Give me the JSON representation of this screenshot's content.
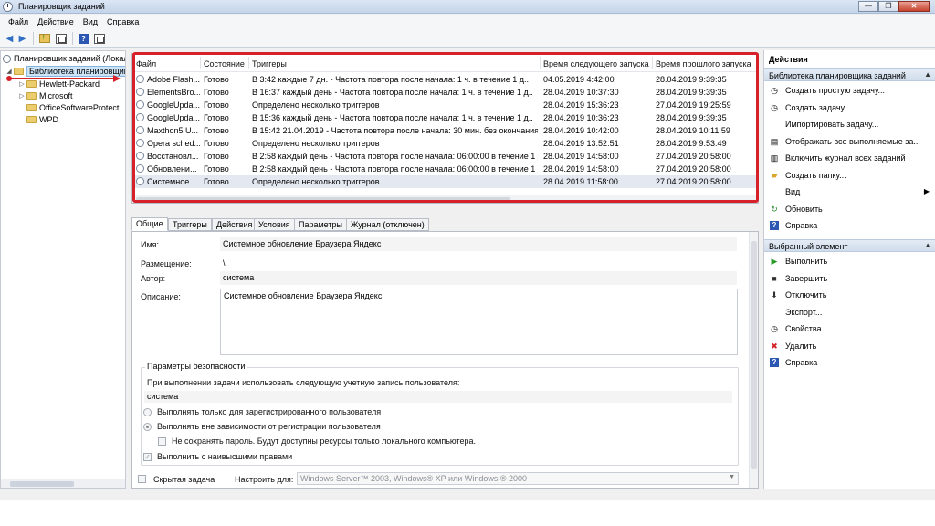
{
  "window": {
    "title": "Планировщик заданий",
    "min_glyph": "—",
    "max_glyph": "❐",
    "close_glyph": "✕"
  },
  "menu": [
    "Файл",
    "Действие",
    "Вид",
    "Справка"
  ],
  "toolbar": {
    "back_glyph": "◀",
    "forward_glyph": "▶",
    "help_glyph": "?",
    "icons": [
      "back-arrow-icon",
      "forward-arrow-icon",
      "folder-up-icon",
      "show-pane-icon",
      "help-icon",
      "action-pane-icon"
    ]
  },
  "tree": {
    "root": "Планировщик заданий (Локальный)",
    "library": "Библиотека планировщика",
    "children": [
      "Hewlett-Packard",
      "Microsoft",
      "OfficeSoftwareProtect",
      "WPD"
    ]
  },
  "tasks": {
    "columns": [
      "Файл",
      "Состояние",
      "Триггеры",
      "Время следующего запуска",
      "Время прошлого запуска"
    ],
    "rows": [
      [
        "Adobe Flash...",
        "Готово",
        "В 3:42 каждые 7 дн. - Частота повтора после начала: 1 ч. в течение 1 д..",
        "04.05.2019 4:42:00",
        "28.04.2019 9:39:35"
      ],
      [
        "ElementsBro...",
        "Готово",
        "В 16:37 каждый день - Частота повтора после начала: 1 ч. в течение 1 д..",
        "28.04.2019 10:37:30",
        "28.04.2019 9:39:35"
      ],
      [
        "GoogleUpda...",
        "Готово",
        "Определено несколько триггеров",
        "28.04.2019 15:36:23",
        "27.04.2019 19:25:59"
      ],
      [
        "GoogleUpda...",
        "Готово",
        "В 15:36 каждый день - Частота повтора после начала: 1 ч. в течение 1 д..",
        "28.04.2019 10:36:23",
        "28.04.2019 9:39:35"
      ],
      [
        "Maxthon5 U...",
        "Готово",
        "В 15:42 21.04.2019 - Частота повтора после начала: 30 мин. без окончания.",
        "28.04.2019 10:42:00",
        "28.04.2019 10:11:59"
      ],
      [
        "Opera sched...",
        "Готово",
        "Определено несколько триггеров",
        "28.04.2019 13:52:51",
        "28.04.2019 9:53:49"
      ],
      [
        "Восстановл...",
        "Готово",
        "В 2:58 каждый день - Частота повтора после начала: 06:00:00 в течение 1 д..",
        "28.04.2019 14:58:00",
        "27.04.2019 20:58:00"
      ],
      [
        "Обновлени...",
        "Готово",
        "В 2:58 каждый день - Частота повтора после начала: 06:00:00 в течение 1 д..",
        "28.04.2019 14:58:00",
        "27.04.2019 20:58:00"
      ],
      [
        "Системное ...",
        "Готово",
        "Определено несколько триггеров",
        "28.04.2019 11:58:00",
        "27.04.2019 20:58:00"
      ]
    ],
    "selected_row": 8
  },
  "tabs": [
    "Общие",
    "Триггеры",
    "Действия",
    "Условия",
    "Параметры",
    "Журнал (отключен)"
  ],
  "general": {
    "name_label": "Имя:",
    "name_value": "Системное обновление Браузера Яндекс",
    "location_label": "Размещение:",
    "location_value": "\\",
    "author_label": "Автор:",
    "author_value": "система",
    "description_label": "Описание:",
    "description_value": "Системное обновление Браузера Яндекс",
    "security_title": "Параметры безопасности",
    "account_prompt": "При выполнении задачи использовать следующую учетную запись пользователя:",
    "account_value": "система",
    "radio_logged_on": "Выполнять только для зарегистрированного пользователя",
    "radio_whether_logged": "Выполнять вне зависимости от регистрации пользователя",
    "no_store_password": "Не сохранять пароль. Будут доступны ресурсы только локального компьютера.",
    "highest_privileges": "Выполнить с наивысшими правами",
    "hidden_task": "Скрытая задача",
    "configure_for_label": "Настроить для:",
    "configure_for_value": "Windows Server™ 2003, Windows® XP или Windows ® 2000"
  },
  "actions": {
    "header": "Действия",
    "section1": "Библиотека планировщика заданий",
    "items1": [
      {
        "icon": "create-basic-task-icon",
        "glyph": "◷",
        "label": "Создать простую задачу..."
      },
      {
        "icon": "create-task-icon",
        "glyph": "◷",
        "label": "Создать задачу..."
      },
      {
        "icon": "",
        "glyph": "",
        "label": "Импортировать задачу..."
      },
      {
        "icon": "display-running-icon",
        "glyph": "▤",
        "label": "Отображать все выполняемые за..."
      },
      {
        "icon": "enable-history-icon",
        "glyph": "▥",
        "label": "Включить журнал всех заданий"
      },
      {
        "icon": "new-folder-icon",
        "glyph": "▰",
        "label": "Создать папку..."
      },
      {
        "icon": "",
        "glyph": "",
        "label": "Вид",
        "submenu": "▶"
      },
      {
        "icon": "refresh-icon",
        "glyph": "↻",
        "label": "Обновить"
      },
      {
        "icon": "help-icon",
        "glyph": "?",
        "label": "Справка"
      }
    ],
    "section2": "Выбранный элемент",
    "items2": [
      {
        "icon": "run-icon",
        "glyph": "▶",
        "label": "Выполнить"
      },
      {
        "icon": "end-icon",
        "glyph": "■",
        "label": "Завершить"
      },
      {
        "icon": "disable-icon",
        "glyph": "⬇",
        "label": "Отключить"
      },
      {
        "icon": "",
        "glyph": "",
        "label": "Экспорт..."
      },
      {
        "icon": "properties-icon",
        "glyph": "◷",
        "label": "Свойства"
      },
      {
        "icon": "delete-icon",
        "glyph": "✖",
        "label": "Удалить"
      },
      {
        "icon": "help-icon",
        "glyph": "?",
        "label": "Справка"
      }
    ],
    "collapse_glyph": "▲"
  },
  "colors": {
    "highlight_red": "#d7212a",
    "run_green": "#2a9a2a",
    "delete_red": "#d2232a",
    "help_blue": "#2b57b3"
  }
}
